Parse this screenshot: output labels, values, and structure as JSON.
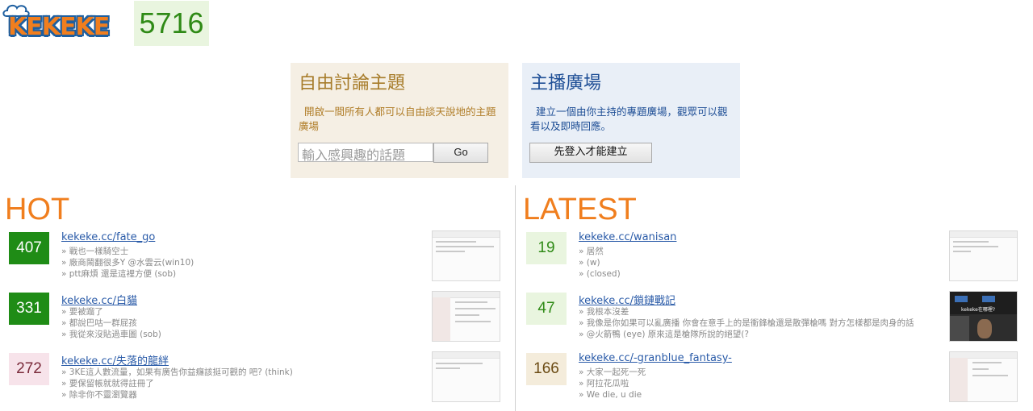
{
  "header": {
    "logo_text": "KEKEKE",
    "visitor_count": "5716"
  },
  "free_topic": {
    "title": "自由討論主題",
    "description": "開啟一間所有人都可以自由談天說地的主題廣場",
    "input_placeholder": "輸入感興趣的話題",
    "go_label": "Go"
  },
  "host_square": {
    "title": "主播廣場",
    "description": "建立一個由你主持的專題廣場，觀眾可以觀看以及即時回應。",
    "login_label": "先登入才能建立"
  },
  "hot": {
    "title": "HOT",
    "items": [
      {
        "count": "407",
        "link": "kekeke.cc/fate_go",
        "comments": [
          "戰也一樣騎空士",
          "廠商鬧翻很多Y @水雲云(win10)",
          "ptt麻煩 還是這裡方便 (sob)"
        ]
      },
      {
        "count": "331",
        "link": "kekeke.cc/白貓",
        "comments": [
          "要被蹓了",
          "都說巴咕一群屁孩",
          "我從來沒貼過車圖 (sob)"
        ]
      },
      {
        "count": "272",
        "link": "kekeke.cc/失落的龍絆",
        "comments": [
          "3KE這人數流量，如果有廣告你益癮該挺可觀的 吧? (think)",
          "要保留帳就就得註冊了",
          "除非你不靈瀏覽器"
        ]
      }
    ]
  },
  "latest": {
    "title": "LATEST",
    "items": [
      {
        "count": "19",
        "link": "kekeke.cc/wanisan",
        "comments": [
          "居然",
          "(w)",
          "(closed)"
        ]
      },
      {
        "count": "47",
        "link": "kekeke.cc/鎖鏈戰記",
        "comments": [
          "我根本沒差",
          "我像是你如果可以亂廣播 你會在意手上的是衝鋒槍還是散彈槍嗎 對方怎樣都是肉身的話",
          "@火箭鴨 (eye) 原來這是槍隊所說的絕望(?"
        ]
      },
      {
        "count": "166",
        "link": "kekeke.cc/-granblue_fantasy-",
        "comments": [
          "大家一起死一死",
          "阿拉花瓜啦",
          "We die, u die"
        ]
      }
    ]
  },
  "thumb_text": "kekeke在哪裡?",
  "colors": {
    "accent_orange": "#f07e1e",
    "hot_green": "#1f8c16",
    "link_blue": "#2a5ba8"
  }
}
